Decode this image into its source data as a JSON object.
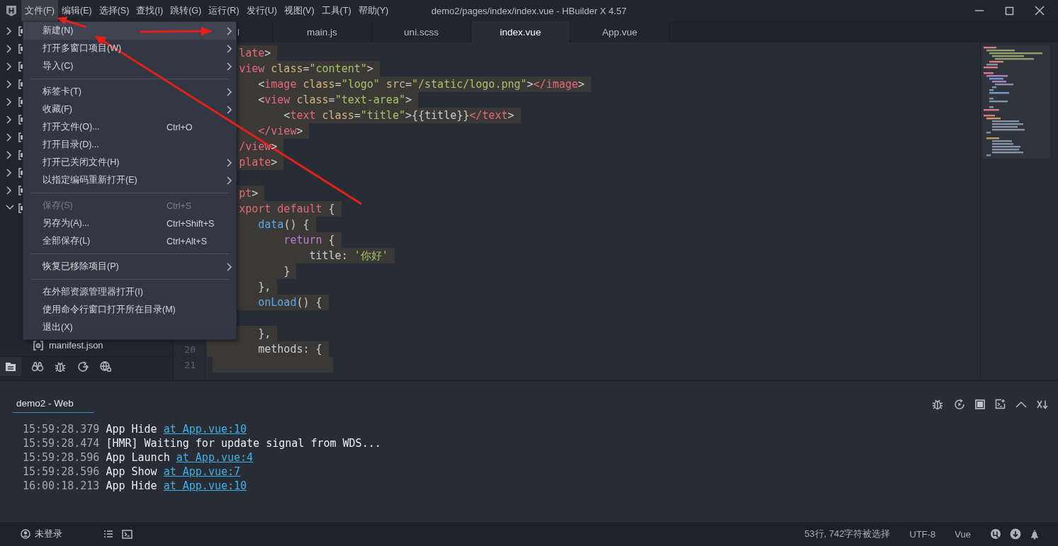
{
  "window": {
    "title": "demo2/pages/index/index.vue - HBuilder X 4.57"
  },
  "menu_bar": [
    {
      "label": "文件(F)",
      "selected": true
    },
    {
      "label": "编辑(E)",
      "selected": false
    },
    {
      "label": "选择(S)",
      "selected": false
    },
    {
      "label": "查找(I)",
      "selected": false
    },
    {
      "label": "跳转(G)",
      "selected": false
    },
    {
      "label": "运行(R)",
      "selected": false
    },
    {
      "label": "发行(U)",
      "selected": false
    },
    {
      "label": "视图(V)",
      "selected": false
    },
    {
      "label": "工具(T)",
      "selected": false
    },
    {
      "label": "帮助(Y)",
      "selected": false
    }
  ],
  "file_menu": [
    {
      "kind": "item",
      "label": "新建(N)",
      "submenu": true,
      "disabled": false,
      "selected": true
    },
    {
      "kind": "item",
      "label": "打开多窗口项目(W)",
      "submenu": true,
      "disabled": false,
      "selected": false
    },
    {
      "kind": "item",
      "label": "导入(C)",
      "submenu": true,
      "disabled": false,
      "selected": false
    },
    {
      "kind": "separator"
    },
    {
      "kind": "item",
      "label": "标签卡(T)",
      "submenu": true,
      "disabled": false,
      "selected": false
    },
    {
      "kind": "item",
      "label": "收藏(F)",
      "submenu": true,
      "disabled": false,
      "selected": false
    },
    {
      "kind": "item",
      "label": "打开文件(O)...",
      "shortcut": "Ctrl+O",
      "submenu": false,
      "disabled": false,
      "selected": false
    },
    {
      "kind": "item",
      "label": "打开目录(D)...",
      "submenu": false,
      "disabled": false,
      "selected": false
    },
    {
      "kind": "item",
      "label": "打开已关闭文件(H)",
      "submenu": true,
      "disabled": false,
      "selected": false
    },
    {
      "kind": "item",
      "label": "以指定编码重新打开(E)",
      "submenu": true,
      "disabled": false,
      "selected": false
    },
    {
      "kind": "separator"
    },
    {
      "kind": "item",
      "label": "保存(S)",
      "shortcut": "Ctrl+S",
      "submenu": false,
      "disabled": true,
      "selected": false
    },
    {
      "kind": "item",
      "label": "另存为(A)...",
      "shortcut": "Ctrl+Shift+S",
      "submenu": false,
      "disabled": false,
      "selected": false
    },
    {
      "kind": "item",
      "label": "全部保存(L)",
      "shortcut": "Ctrl+Alt+S",
      "submenu": false,
      "disabled": false,
      "selected": false
    },
    {
      "kind": "separator"
    },
    {
      "kind": "item",
      "label": "恢复已移除项目(P)",
      "submenu": true,
      "disabled": false,
      "selected": false
    },
    {
      "kind": "separator"
    },
    {
      "kind": "item",
      "label": "在外部资源管理器打开(I)",
      "submenu": false,
      "disabled": false,
      "selected": false
    },
    {
      "kind": "item",
      "label": "使用命令行窗口打开所在目录(M)",
      "submenu": false,
      "disabled": false,
      "selected": false
    },
    {
      "kind": "item",
      "label": "退出(X)",
      "submenu": false,
      "disabled": false,
      "selected": false
    }
  ],
  "sidebar": {
    "tree": [
      {
        "expanded": false
      },
      {
        "expanded": false
      },
      {
        "expanded": false
      },
      {
        "expanded": false
      },
      {
        "expanded": false
      },
      {
        "expanded": false
      },
      {
        "expanded": false
      },
      {
        "expanded": false
      },
      {
        "expanded": false
      },
      {
        "expanded": false
      },
      {
        "expanded": true,
        "children": [
          {
            "label": "manifest.json"
          }
        ]
      }
    ]
  },
  "editor_tabs": [
    {
      "label": "l",
      "selected": false
    },
    {
      "label": "main.js",
      "selected": false
    },
    {
      "label": "uni.scss",
      "selected": false
    },
    {
      "label": "index.vue",
      "selected": true
    },
    {
      "label": "App.vue",
      "selected": false
    }
  ],
  "editor": {
    "lines": [
      {
        "selected": true,
        "tokens": [
          {
            "kind": "tag",
            "t": "     late"
          },
          {
            "kind": "punct",
            "t": ">"
          }
        ]
      },
      {
        "selected": true,
        "tokens": [
          {
            "kind": "tag",
            "t": "     view"
          },
          {
            "kind": "attr",
            "t": " class"
          },
          {
            "kind": "punct",
            "t": "="
          },
          {
            "kind": "string",
            "t": "\"content\""
          },
          {
            "kind": "punct",
            "t": ">"
          }
        ]
      },
      {
        "selected": true,
        "tokens": [
          {
            "kind": "punct",
            "t": "        <"
          },
          {
            "kind": "tag",
            "t": "image"
          },
          {
            "kind": "attr",
            "t": " class"
          },
          {
            "kind": "punct",
            "t": "="
          },
          {
            "kind": "string",
            "t": "\"logo\""
          },
          {
            "kind": "attr",
            "t": " src"
          },
          {
            "kind": "punct",
            "t": "="
          },
          {
            "kind": "string",
            "t": "\"/static/logo.png\""
          },
          {
            "kind": "punct",
            "t": ">"
          },
          {
            "kind": "tag",
            "t": "</image"
          },
          {
            "kind": "punct",
            "t": ">"
          }
        ]
      },
      {
        "selected": true,
        "tokens": [
          {
            "kind": "punct",
            "t": "        <"
          },
          {
            "kind": "tag",
            "t": "view"
          },
          {
            "kind": "attr",
            "t": " class"
          },
          {
            "kind": "punct",
            "t": "="
          },
          {
            "kind": "string",
            "t": "\"text-area\""
          },
          {
            "kind": "punct",
            "t": ">"
          }
        ]
      },
      {
        "selected": true,
        "tokens": [
          {
            "kind": "punct",
            "t": "            <"
          },
          {
            "kind": "tag",
            "t": "text"
          },
          {
            "kind": "attr",
            "t": " class"
          },
          {
            "kind": "punct",
            "t": "="
          },
          {
            "kind": "string",
            "t": "\"title\""
          },
          {
            "kind": "punct",
            "t": ">{{title}}"
          },
          {
            "kind": "tag",
            "t": "</text"
          },
          {
            "kind": "punct",
            "t": ">"
          }
        ]
      },
      {
        "selected": true,
        "tokens": [
          {
            "kind": "tag",
            "t": "        </view"
          },
          {
            "kind": "punct",
            "t": ">"
          }
        ]
      },
      {
        "selected": true,
        "tokens": [
          {
            "kind": "tag",
            "t": "     /view"
          },
          {
            "kind": "punct",
            "t": ">"
          }
        ]
      },
      {
        "selected": true,
        "tokens": [
          {
            "kind": "tag",
            "t": "     plate"
          },
          {
            "kind": "punct",
            "t": ">"
          }
        ]
      },
      {
        "kind": "blank"
      },
      {
        "selected": true,
        "tokens": [
          {
            "kind": "tag",
            "t": "     pt"
          },
          {
            "kind": "punct",
            "t": ">"
          }
        ]
      },
      {
        "selected": true,
        "tokens": [
          {
            "kind": "keyword",
            "t": "     xport"
          },
          {
            "kind": "keyword",
            "t": " default"
          },
          {
            "kind": "punct",
            "t": " {"
          }
        ]
      },
      {
        "selected": true,
        "tokens": [
          {
            "kind": "func",
            "t": "        data"
          },
          {
            "kind": "punct",
            "t": "() {"
          }
        ]
      },
      {
        "selected": true,
        "tokens": [
          {
            "kind": "control",
            "t": "            return"
          },
          {
            "kind": "punct",
            "t": " {"
          }
        ]
      },
      {
        "selected": true,
        "tokens": [
          {
            "kind": "plain",
            "t": "                title: "
          },
          {
            "kind": "string",
            "t": "'你好'"
          }
        ]
      },
      {
        "selected": true,
        "tokens": [
          {
            "kind": "punct",
            "t": "            }"
          }
        ]
      },
      {
        "selected": true,
        "tokens": [
          {
            "kind": "punct",
            "t": "        },"
          }
        ]
      },
      {
        "selected": true,
        "tokens": [
          {
            "kind": "func",
            "t": "        onLoad"
          },
          {
            "kind": "punct",
            "t": "() {"
          }
        ]
      },
      {
        "kind": "blank"
      },
      {
        "selected": true,
        "tokens": [
          {
            "kind": "punct",
            "t": "        },"
          }
        ]
      },
      {
        "number": "20",
        "selected": true,
        "tokens": [
          {
            "kind": "plain",
            "t": "        methods: "
          },
          {
            "kind": "punct",
            "t": "{"
          }
        ]
      },
      {
        "kind": "blank",
        "number": "21",
        "selected": true
      }
    ]
  },
  "console": {
    "tab": {
      "label": "demo2 - Web",
      "selected": true
    },
    "lines": [
      {
        "time": "15:59:28.379",
        "message": "App Hide",
        "link": "at App.vue:10"
      },
      {
        "time": "15:59:28.474",
        "message": "[HMR] Waiting for update signal from WDS..."
      },
      {
        "time": "15:59:28.596",
        "message": "App Launch",
        "link": "at App.vue:4"
      },
      {
        "time": "15:59:28.596",
        "message": "App Show",
        "link": "at App.vue:7"
      },
      {
        "time": "16:00:18.213",
        "message": "App Hide",
        "link": "at App.vue:10"
      }
    ]
  },
  "status_bar": {
    "user": "未登录",
    "selection": "53行, 742字符被选择",
    "encoding": "UTF-8",
    "language": "Vue"
  }
}
